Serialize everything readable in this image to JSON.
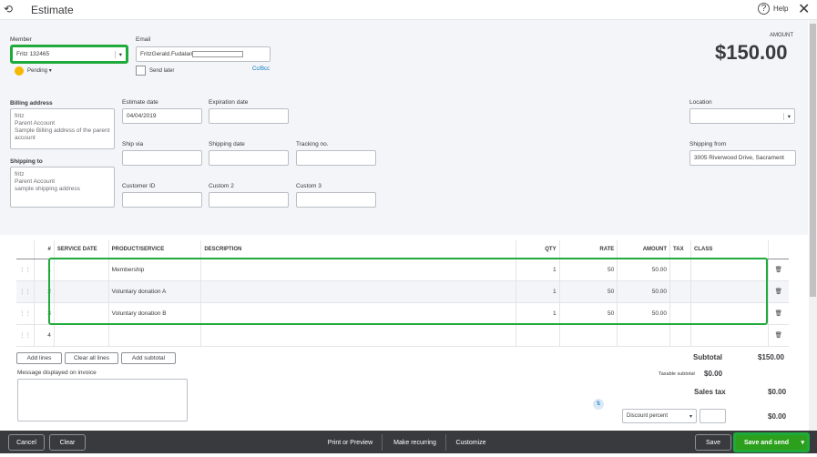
{
  "header": {
    "title": "Estimate",
    "help": "Help"
  },
  "member": {
    "label": "Member",
    "value": "Fritz 132465",
    "status": "Pending"
  },
  "email": {
    "label": "Email",
    "value": "FritzGerald.Fudalan",
    "send_later": "Send later",
    "cc_bcc": "Cc/Bcc"
  },
  "amount": {
    "label": "AMOUNT",
    "value": "$150.00"
  },
  "billing": {
    "label": "Billing address",
    "value": "fritz\nParent Account\nSample Billing address of the parent account"
  },
  "shipping_to": {
    "label": "Shipping to",
    "value": "fritz\nParent Account\nsample shipping address"
  },
  "fields": {
    "estimate_date_label": "Estimate date",
    "estimate_date": "04/04/2019",
    "expiration_label": "Expiration date",
    "ship_via_label": "Ship via",
    "shipping_date_label": "Shipping date",
    "tracking_label": "Tracking no.",
    "customer_id_label": "Customer ID",
    "custom2_label": "Custom 2",
    "custom3_label": "Custom 3",
    "location_label": "Location",
    "shipping_from_label": "Shipping from",
    "shipping_from": "3005 Riverwood Drive, Sacrament"
  },
  "table": {
    "headers": [
      "#",
      "SERVICE DATE",
      "PRODUCT/SERVICE",
      "DESCRIPTION",
      "QTY",
      "RATE",
      "AMOUNT",
      "TAX",
      "CLASS"
    ],
    "rows": [
      {
        "n": "1",
        "product": "Membership",
        "qty": "1",
        "rate": "50",
        "amount": "50.00"
      },
      {
        "n": "2",
        "product": "Voluntary donation A",
        "qty": "1",
        "rate": "50",
        "amount": "50.00"
      },
      {
        "n": "3",
        "product": "Voluntary donation B",
        "qty": "1",
        "rate": "50",
        "amount": "50.00"
      },
      {
        "n": "4",
        "product": "",
        "qty": "",
        "rate": "",
        "amount": ""
      }
    ]
  },
  "actions": {
    "add_lines": "Add lines",
    "clear_all": "Clear all lines",
    "add_subtotal": "Add subtotal"
  },
  "message": {
    "label": "Message displayed on invoice"
  },
  "totals": {
    "subtotal_label": "Subtotal",
    "subtotal": "$150.00",
    "taxable_label": "Taxable subtotal",
    "taxable": "$0.00",
    "sales_tax_label": "Sales tax",
    "sales_tax": "$0.00",
    "discount_type": "Discount percent",
    "discount": "$0.00"
  },
  "footer": {
    "cancel": "Cancel",
    "clear": "Clear",
    "print": "Print or Preview",
    "recurring": "Make recurring",
    "customize": "Customize",
    "save": "Save",
    "save_send": "Save and send"
  }
}
